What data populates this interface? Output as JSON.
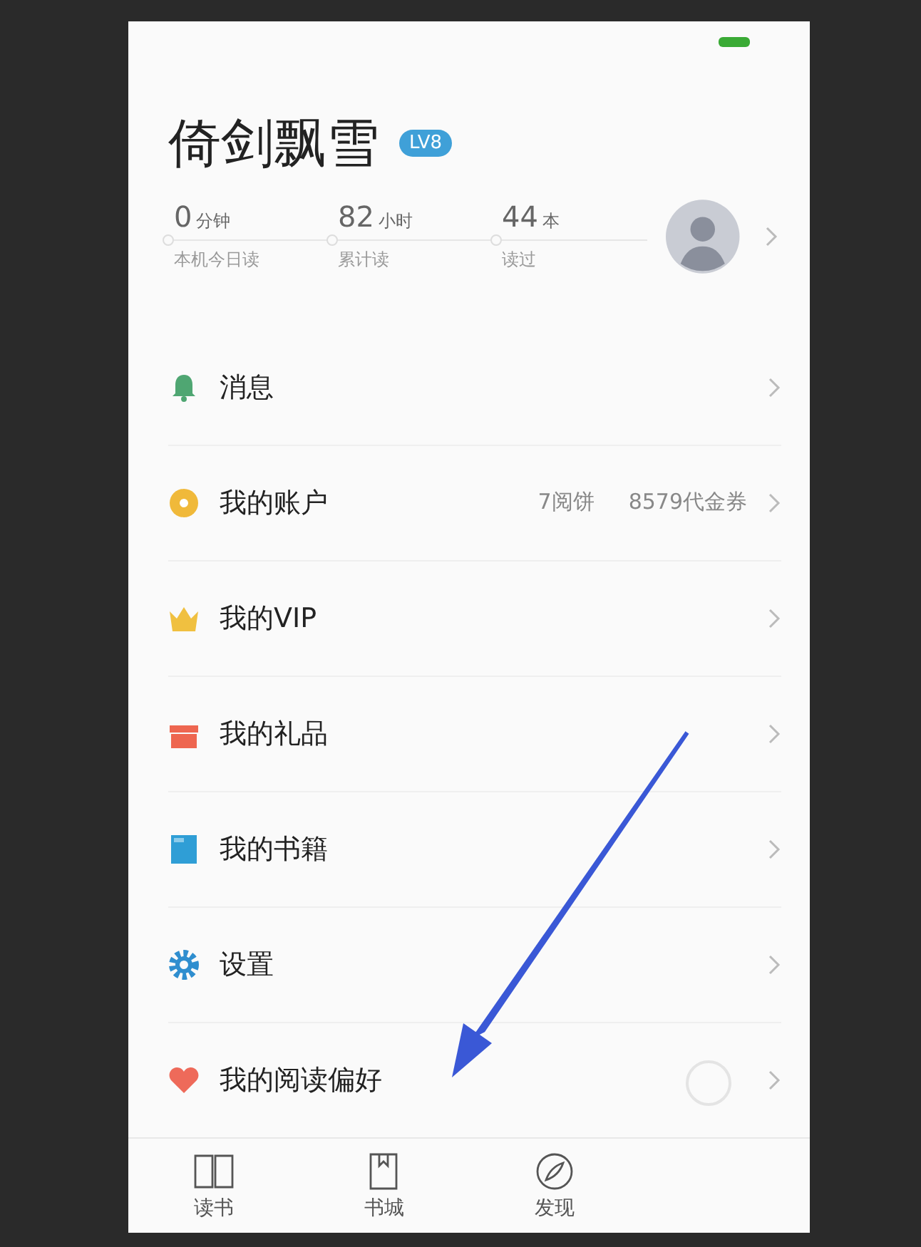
{
  "profile": {
    "name": "倚剑飘雪",
    "level_badge": "LV8",
    "stats": [
      {
        "value": "0",
        "unit": "分钟",
        "label": "本机今日读"
      },
      {
        "value": "82",
        "unit": "小时",
        "label": "累计读"
      },
      {
        "value": "44",
        "unit": "本",
        "label": "读过"
      }
    ]
  },
  "menu": [
    {
      "kind": "bell",
      "label": "消息"
    },
    {
      "kind": "coin",
      "label": "我的账户",
      "details": [
        "7阅饼",
        "8579代金券"
      ]
    },
    {
      "kind": "crown",
      "label": "我的VIP"
    },
    {
      "kind": "gift",
      "label": "我的礼品"
    },
    {
      "kind": "book",
      "label": "我的书籍"
    },
    {
      "kind": "gear",
      "label": "设置"
    },
    {
      "kind": "heart",
      "label": "我的阅读偏好"
    }
  ],
  "tabs": [
    {
      "kind": "book",
      "label": "读书",
      "selected": false
    },
    {
      "kind": "store",
      "label": "书城",
      "selected": false
    },
    {
      "kind": "compass",
      "label": "发现",
      "selected": false
    }
  ]
}
